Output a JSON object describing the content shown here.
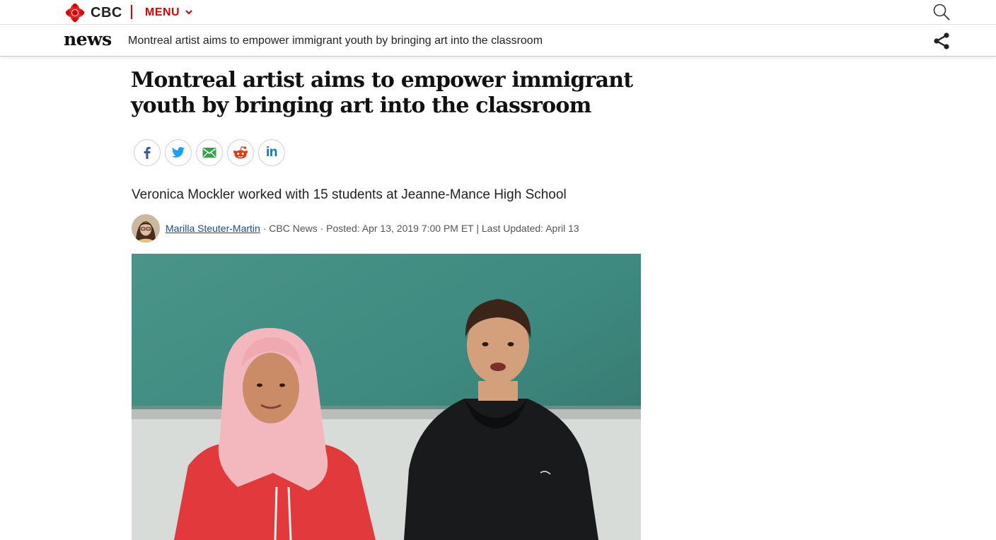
{
  "topbar": {
    "brand": "CBC",
    "menu_label": "MENU"
  },
  "newsbar": {
    "section": "news",
    "headline": "Montreal artist aims to empower immigrant youth by bringing art into the classroom"
  },
  "article": {
    "headline": "Montreal artist aims to empower immigrant youth by bringing art into the classroom",
    "deck": "Veronica Mockler worked with 15 students at Jeanne-Mance High School",
    "author": "Marilla Steuter-Martin",
    "meta": " · CBC News · Posted: Apr 13, 2019 7:00 PM ET | Last Updated: April 13"
  },
  "share_buttons": [
    "facebook-icon",
    "twitter-icon",
    "email-icon",
    "reddit-icon",
    "linkedin-icon"
  ],
  "colors": {
    "cbc_red": "#d00000",
    "link_blue": "#1a4a8c",
    "chalkboard": "#3e8c82"
  }
}
